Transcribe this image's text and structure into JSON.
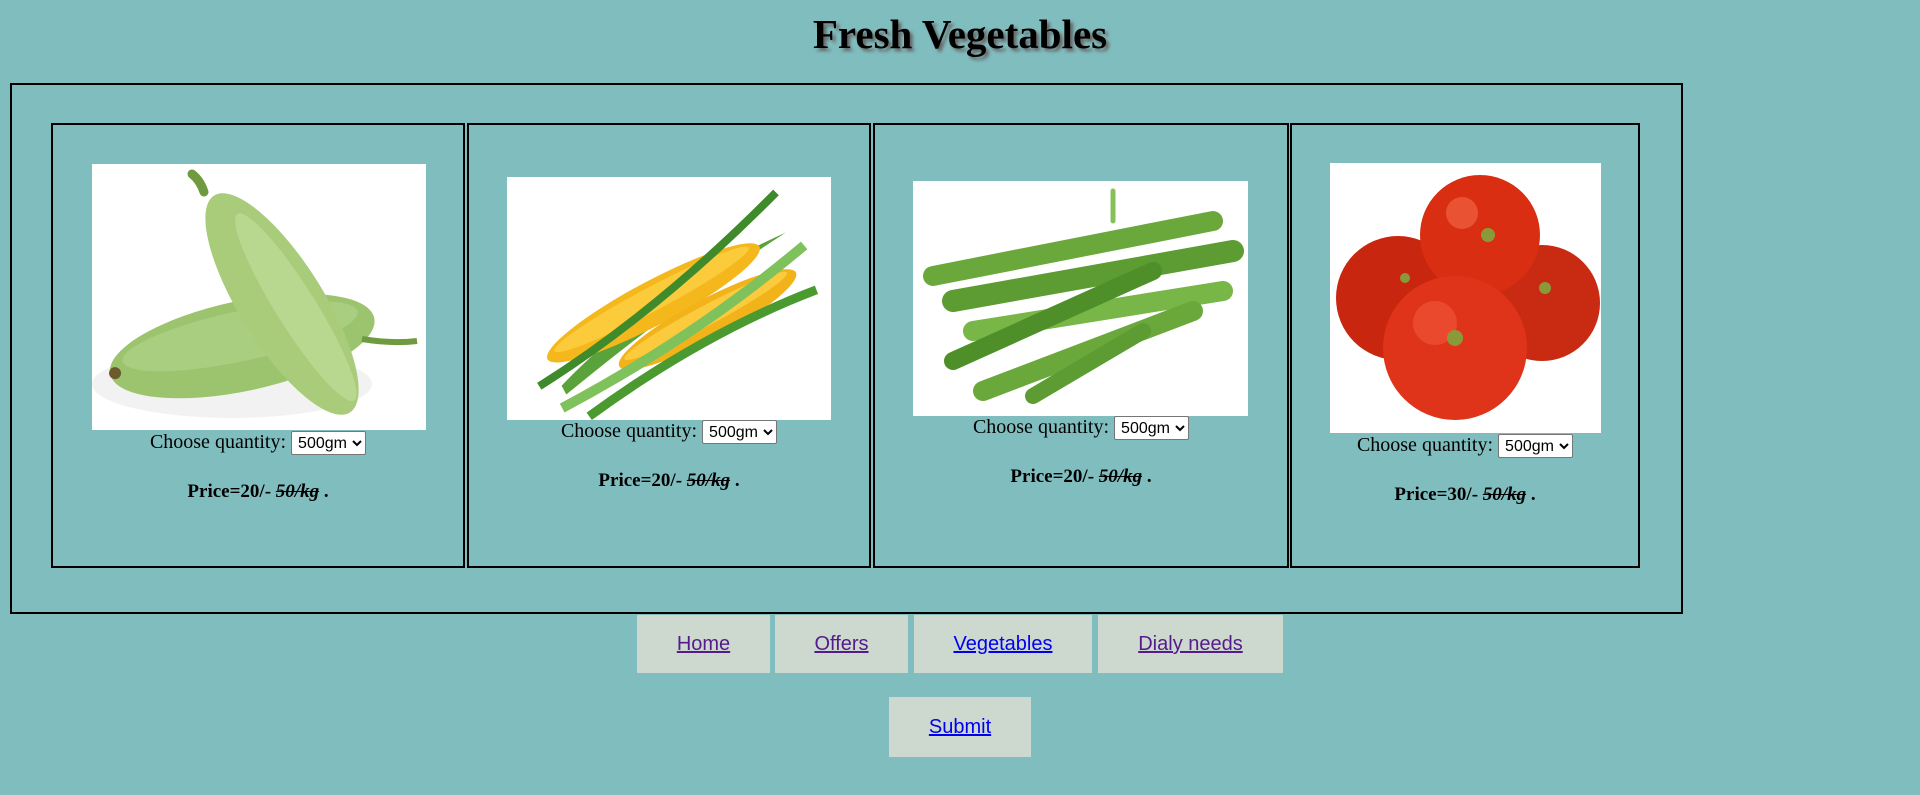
{
  "page": {
    "title": "Fresh Vegetables"
  },
  "quantity_label": "Choose quantity:",
  "products": [
    {
      "name": "bottle-gourd",
      "quantity": "500gm",
      "price": "Price=20/-",
      "old_price": "50/kg",
      "suffix": " ."
    },
    {
      "name": "corn",
      "quantity": "500gm",
      "price": "Price=20/-",
      "old_price": "50/kg",
      "suffix": " ."
    },
    {
      "name": "okra",
      "quantity": "500gm",
      "price": "Price=20/-",
      "old_price": "50/kg",
      "suffix": " ."
    },
    {
      "name": "tomato",
      "quantity": "500gm",
      "price": "Price=30/-",
      "old_price": "50/kg",
      "suffix": " ."
    }
  ],
  "nav": {
    "home": "Home",
    "offers": "Offers",
    "vegetables": "Vegetables",
    "daily_needs": "Dialy needs"
  },
  "submit_label": "Submit",
  "colors": {
    "background": "#80bdbf",
    "nav_button": "#cdd8cf",
    "visited_link": "#551a8b",
    "link": "#0000ee"
  }
}
